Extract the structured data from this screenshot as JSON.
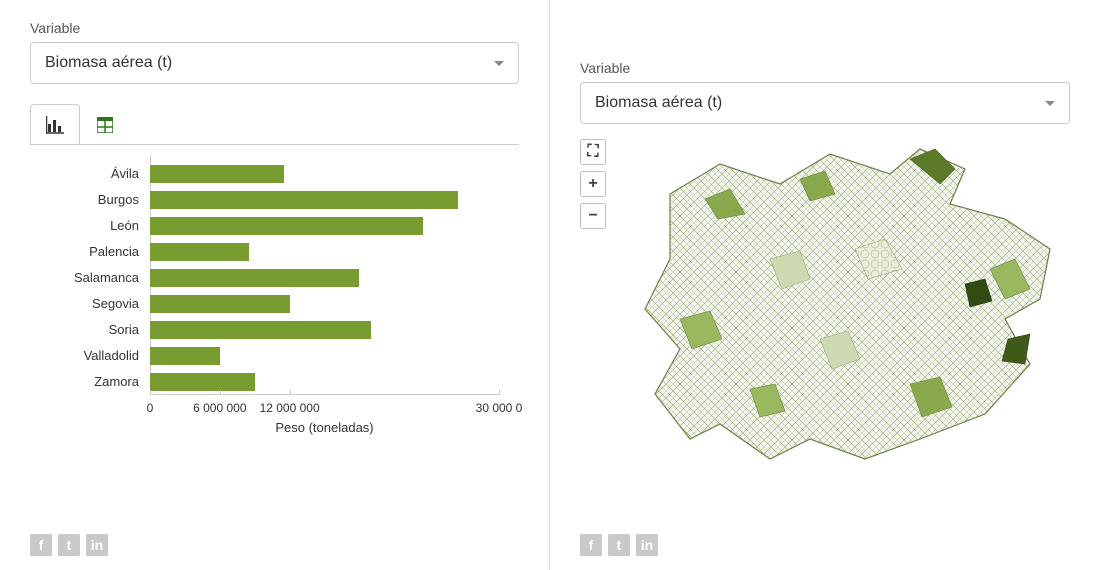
{
  "left": {
    "variable_label": "Variable",
    "variable_value": "Biomasa aérea (t)"
  },
  "right": {
    "variable_label": "Variable",
    "variable_value": "Biomasa aérea (t)"
  },
  "social": {
    "fb": "f",
    "tw": "t",
    "in": "in"
  },
  "map_controls": {
    "fit": "⛶",
    "plus": "+",
    "minus": "−"
  },
  "chart_data": {
    "type": "bar",
    "orientation": "horizontal",
    "categories": [
      "Ávila",
      "Burgos",
      "León",
      "Palencia",
      "Salamanca",
      "Segovia",
      "Soria",
      "Valladolid",
      "Zamora"
    ],
    "values": [
      11500000,
      26500000,
      23500000,
      8500000,
      18000000,
      12000000,
      19000000,
      6000000,
      9000000
    ],
    "xlabel": "Peso (toneladas)",
    "ylabel": "",
    "title": "",
    "xlim": [
      0,
      30000000
    ],
    "x_ticks": [
      {
        "value": 0,
        "label": "0"
      },
      {
        "value": 6000000,
        "label": "6 000 000"
      },
      {
        "value": 12000000,
        "label": "12 000 000"
      },
      {
        "value": 30000000,
        "label": "30 000 0"
      }
    ],
    "bar_color": "#789c2f"
  }
}
